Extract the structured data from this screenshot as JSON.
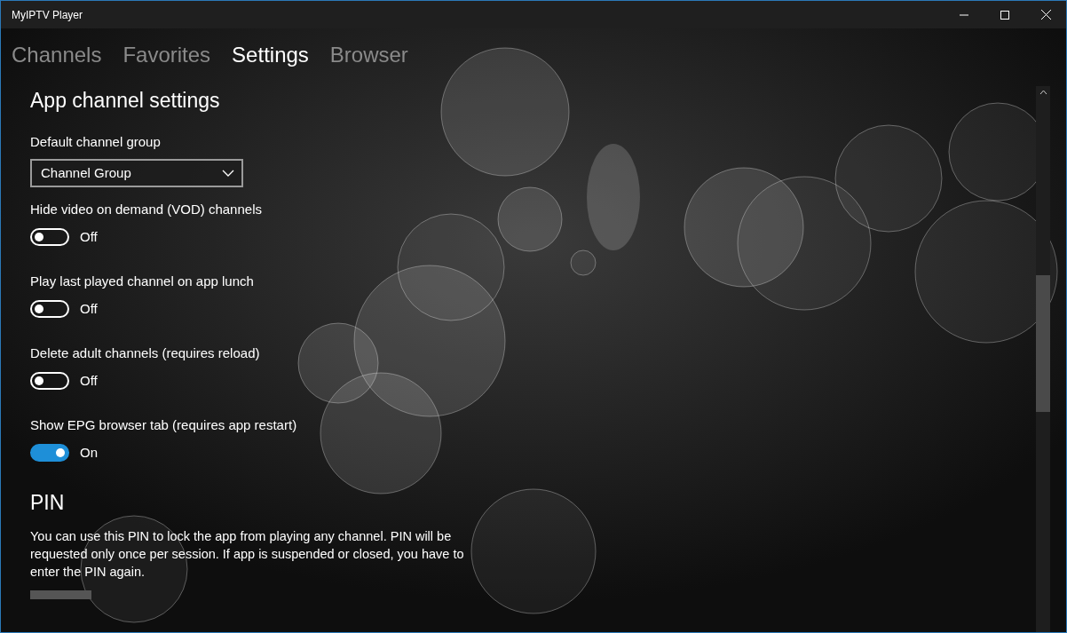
{
  "window": {
    "title": "MyIPTV Player"
  },
  "tabs": [
    {
      "label": "Channels",
      "selected": false
    },
    {
      "label": "Favorites",
      "selected": false
    },
    {
      "label": "Settings",
      "selected": true
    },
    {
      "label": "Browser",
      "selected": false
    }
  ],
  "section": {
    "title": "App channel settings",
    "settings": [
      {
        "kind": "dropdown",
        "label": "Default channel group",
        "value": "Channel Group"
      },
      {
        "kind": "toggle",
        "label": "Hide video on demand (VOD) channels",
        "on": false,
        "state_text": "Off"
      },
      {
        "kind": "toggle",
        "label": "Play last played channel on app lunch",
        "on": false,
        "state_text": "Off"
      },
      {
        "kind": "toggle",
        "label": "Delete adult channels (requires reload)",
        "on": false,
        "state_text": "Off"
      },
      {
        "kind": "toggle",
        "label": "Show EPG browser tab (requires app restart)",
        "on": true,
        "state_text": "On"
      }
    ]
  },
  "pin": {
    "title": "PIN",
    "description": "You can use this PIN to lock the app from playing any channel. PIN will be requested only once per session. If app is suspended or closed, you have to enter the PIN again."
  }
}
